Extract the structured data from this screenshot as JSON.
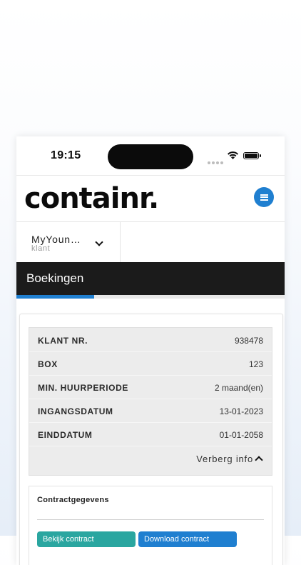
{
  "status_bar": {
    "time": "19:15"
  },
  "header": {
    "logo_text": "containr."
  },
  "client": {
    "name": "MyYoun…",
    "role": "klant"
  },
  "page": {
    "title": "Boekingen",
    "progress": 0.29
  },
  "info": {
    "rows": [
      {
        "label": "KLANT NR.",
        "value": "938478"
      },
      {
        "label": "BOX",
        "value": "123"
      },
      {
        "label": "MIN. HUURPERIODE",
        "value": "2 maand(en)"
      },
      {
        "label": "INGANGSDATUM",
        "value": "13-01-2023"
      },
      {
        "label": "EINDDATUM",
        "value": "01-01-2058"
      }
    ],
    "toggle_label": "Verberg info"
  },
  "contract": {
    "title": "Contractgegevens",
    "buttons": [
      {
        "label": "Bekijk contract"
      },
      {
        "label": "Download contract"
      }
    ]
  },
  "colors": {
    "accent": "#1f7fd0",
    "teal": "#2aa6a0",
    "title_bar": "#1b1b1b"
  }
}
